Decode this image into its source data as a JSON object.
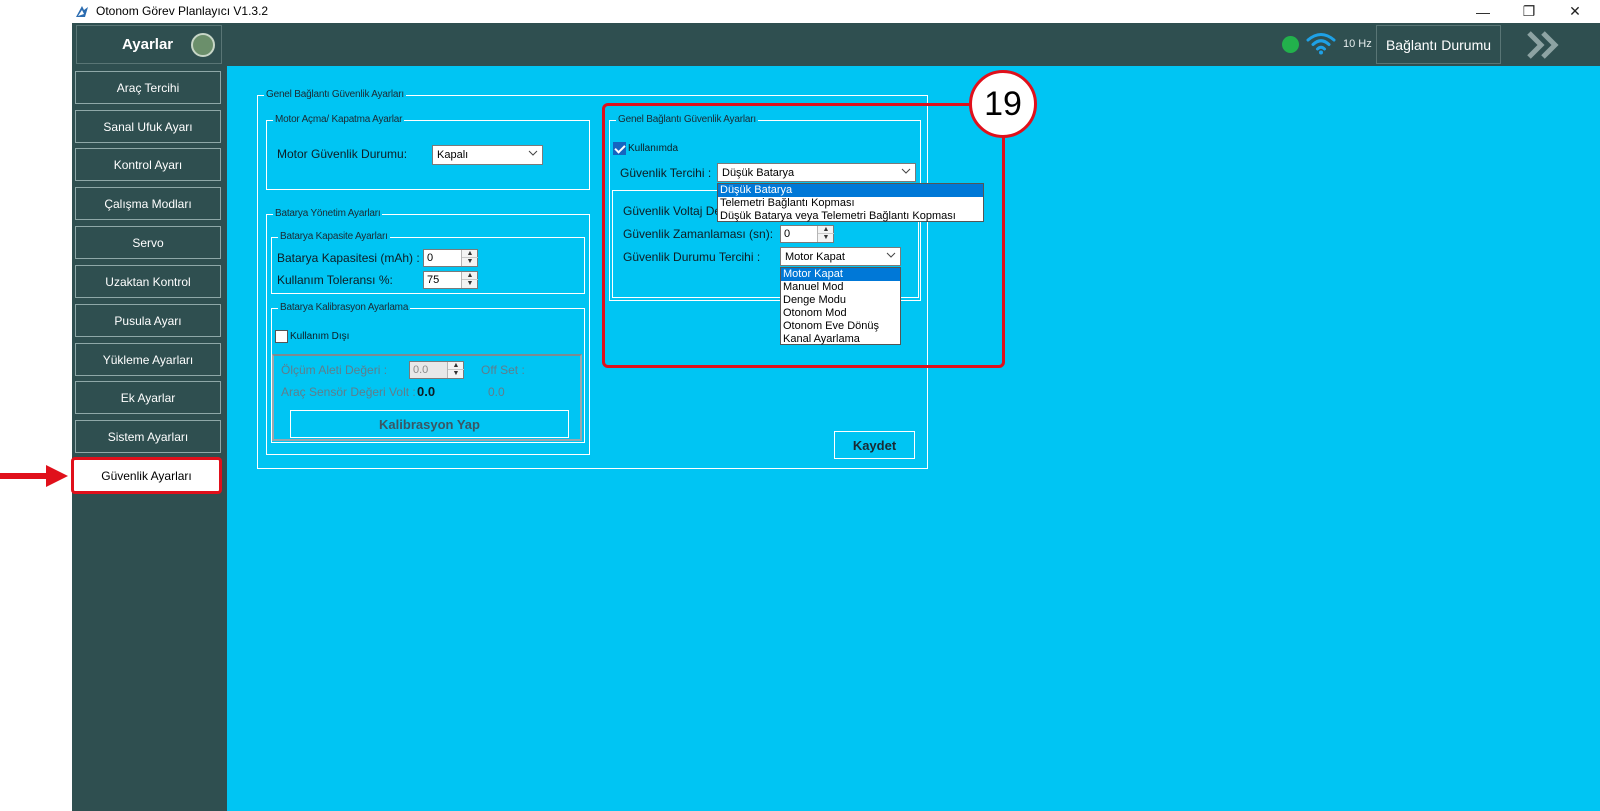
{
  "window": {
    "title": "Otonom Görev Planlayıcı V1.3.2",
    "minimize_glyph": "—",
    "maximize_glyph": "❐",
    "close_glyph": "✕"
  },
  "header": {
    "title": "Ayarlar",
    "hz": "10 Hz",
    "connection_button": "Bağlantı Durumu",
    "status_color": "#22b14c"
  },
  "sidebar": {
    "items": [
      {
        "label": "Araç Tercihi"
      },
      {
        "label": "Sanal Ufuk Ayarı"
      },
      {
        "label": "Kontrol Ayarı"
      },
      {
        "label": "Çalışma Modları"
      },
      {
        "label": "Servo"
      },
      {
        "label": "Uzaktan Kontrol"
      },
      {
        "label": "Pusula Ayarı"
      },
      {
        "label": "Yükleme Ayarları"
      },
      {
        "label": "Ek Ayarlar"
      },
      {
        "label": "Sistem Ayarları"
      },
      {
        "label": "Güvenlik Ayarları"
      }
    ],
    "active_item": "Güvenlik Ayarları"
  },
  "main": {
    "outer_group": "Genel Bağlantı Güvenlik Ayarları",
    "motor_group": {
      "legend": "Motor Açma/ Kapatma Ayarlar",
      "label": "Motor Güvenlik Durumu:",
      "value": "Kapalı"
    },
    "battery_group": {
      "legend": "Batarya Yönetim Ayarları",
      "capacity_group": {
        "legend": "Batarya Kapasite Ayarları",
        "capacity_label": "Batarya Kapasitesi (mAh) :",
        "capacity_value": "0",
        "tolerance_label": "Kullanım Toleransı %:",
        "tolerance_value": "75"
      },
      "calibration_group": {
        "legend": "Batarya Kalibrasyon Ayarlama",
        "checkbox_label": "Kullanım Dışı",
        "measure_label": "Ölçüm Aleti Değeri :",
        "measure_value": "0.0",
        "offset_label": "Off Set :",
        "sensor_label": "Araç Sensör Değeri Volt :",
        "sensor_value": "0.0",
        "offset_value": "0.0",
        "button": "Kalibrasyon Yap"
      }
    },
    "connection_group": {
      "legend": "Genel Bağlantı Güvenlik Ayarları",
      "checkbox_label": "Kullanımda",
      "preference_label": "Güvenlik Tercihi :",
      "preference_value": "Düşük Batarya",
      "preference_options": [
        "Düşük Batarya",
        "Telemetri Bağlantı Kopması",
        "Düşük Batarya veya Telemetri Bağlantı Kopması"
      ],
      "voltage_label": "Güvenlik Voltaj De",
      "timing_label": "Güvenlik Zamanlaması (sn):",
      "timing_value": "0",
      "state_label": "Güvenlik Durumu Tercihi :",
      "state_value": "Motor Kapat",
      "state_options": [
        "Motor Kapat",
        "Manuel Mod",
        "Denge Modu",
        "Otonom Mod",
        "Otonom Eve Dönüş",
        "Kanal Ayarlama"
      ]
    },
    "save_button": "Kaydet"
  },
  "annotation": {
    "badge": "19",
    "color": "#e0101b"
  }
}
